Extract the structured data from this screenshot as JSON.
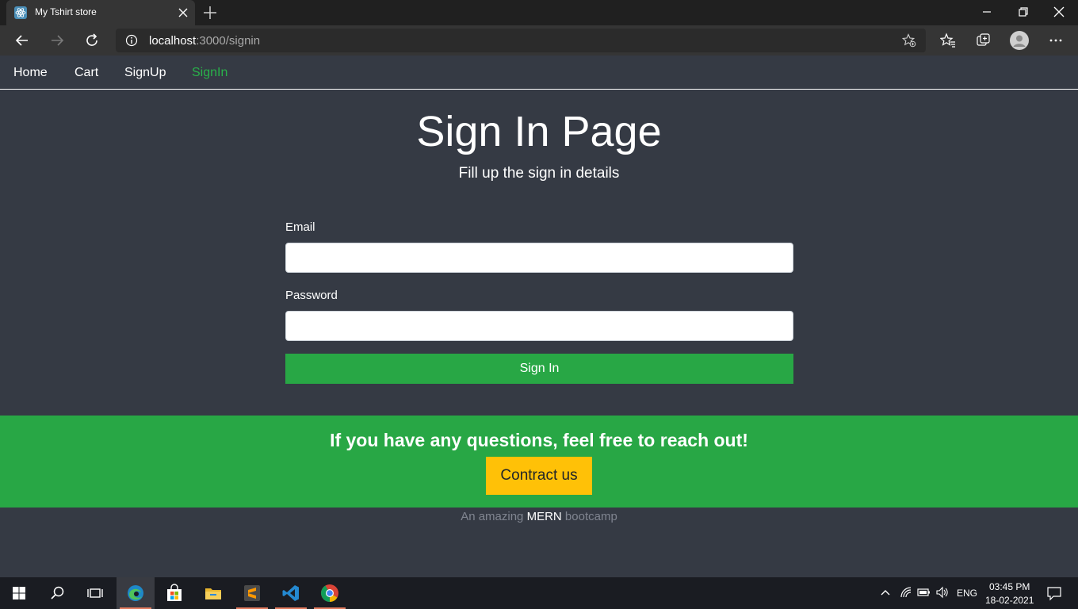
{
  "browser": {
    "tab_title": "My Tshirt store",
    "url_host": "localhost",
    "url_path": ":3000/signin"
  },
  "navbar": {
    "items": [
      {
        "label": "Home",
        "active": false
      },
      {
        "label": "Cart",
        "active": false
      },
      {
        "label": "SignUp",
        "active": false
      },
      {
        "label": "SignIn",
        "active": true
      }
    ]
  },
  "page": {
    "title": "Sign In Page",
    "subtitle": "Fill up the sign in details"
  },
  "form": {
    "email_label": "Email",
    "email_value": "",
    "password_label": "Password",
    "password_value": "",
    "submit_label": "Sign In"
  },
  "footer": {
    "message": "If you have any questions, feel free to reach out!",
    "contact_label": "Contract us",
    "note_prefix": "An amazing ",
    "note_highlight": "MERN",
    "note_suffix": " bootcamp"
  },
  "taskbar": {
    "language": "ENG",
    "time": "03:45 PM",
    "date": "18-02-2021"
  },
  "colors": {
    "accent_green": "#28a745",
    "active_link": "#29b24a",
    "contact_yellow": "#ffc107",
    "page_background": "#353a44"
  }
}
